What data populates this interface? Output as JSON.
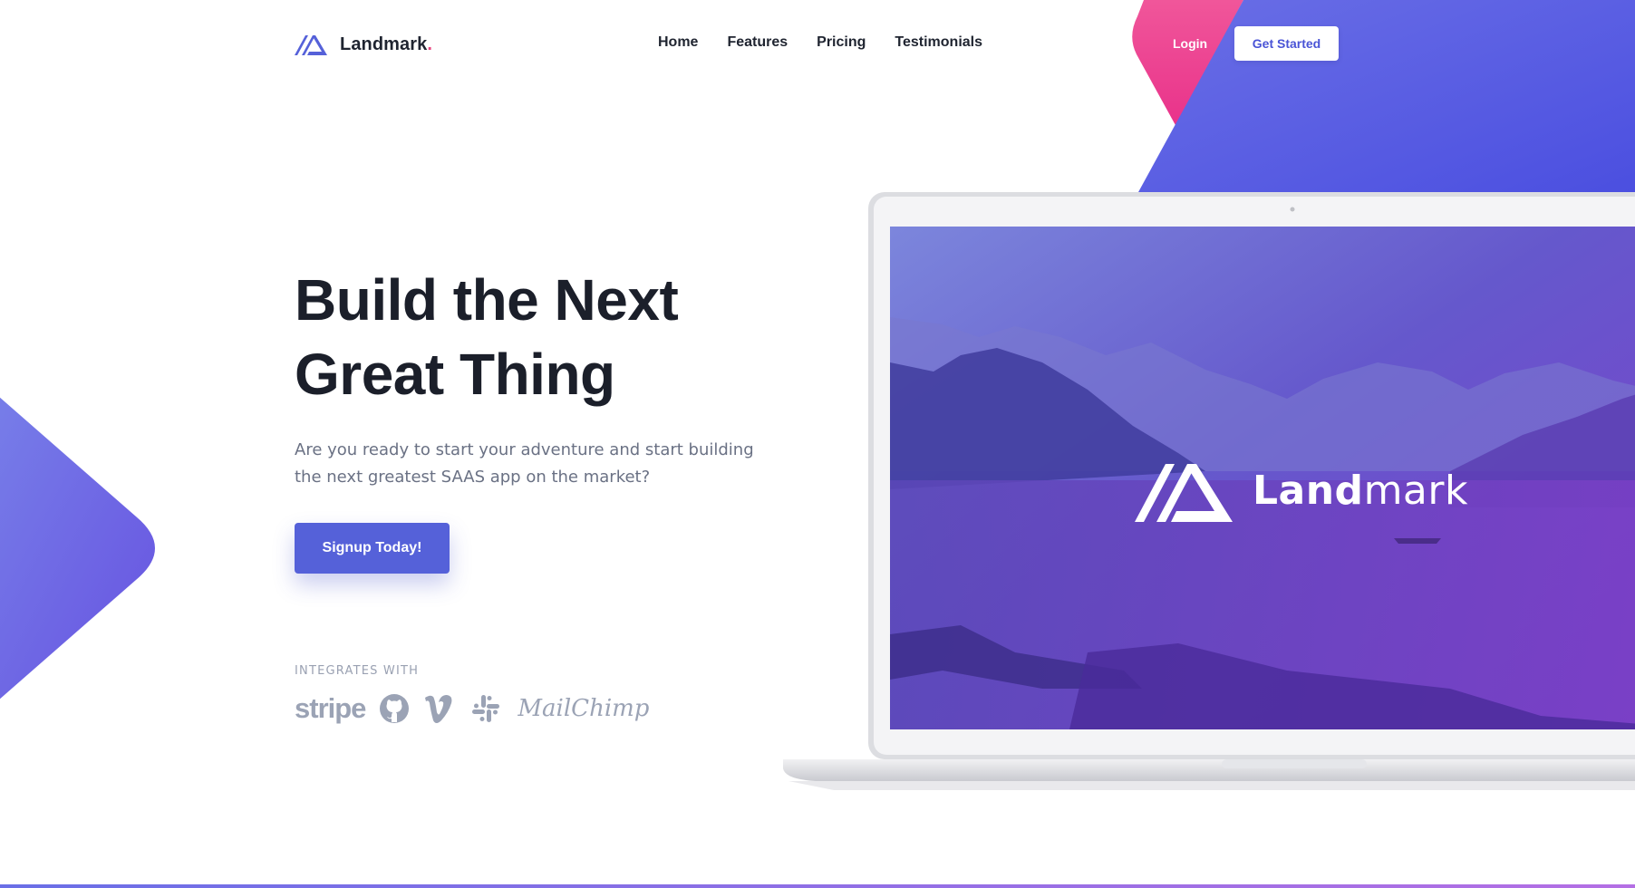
{
  "brand": {
    "name": "Landmark",
    "dot": ".",
    "accent": "#e8457f",
    "primary": "#5561d9"
  },
  "nav": {
    "items": [
      {
        "label": "Home"
      },
      {
        "label": "Features"
      },
      {
        "label": "Pricing"
      },
      {
        "label": "Testimonials"
      }
    ],
    "login_label": "Login",
    "get_started_label": "Get Started"
  },
  "hero": {
    "title_line1": "Build the Next",
    "title_line2": "Great Thing",
    "subtitle": "Are you ready to start your adventure and start building the next greatest SAAS app on the market?",
    "cta_label": "Signup Today!"
  },
  "integrations": {
    "label": "INTEGRATES WITH",
    "items": [
      {
        "name": "stripe",
        "icon": "stripe-logo"
      },
      {
        "name": "github",
        "icon": "github-icon"
      },
      {
        "name": "vimeo",
        "icon": "vimeo-icon"
      },
      {
        "name": "slack",
        "icon": "slack-icon"
      },
      {
        "name": "MailChimp",
        "icon": "mailchimp-logo"
      }
    ]
  },
  "screen": {
    "logo_bold": "Land",
    "logo_light": "mark"
  }
}
